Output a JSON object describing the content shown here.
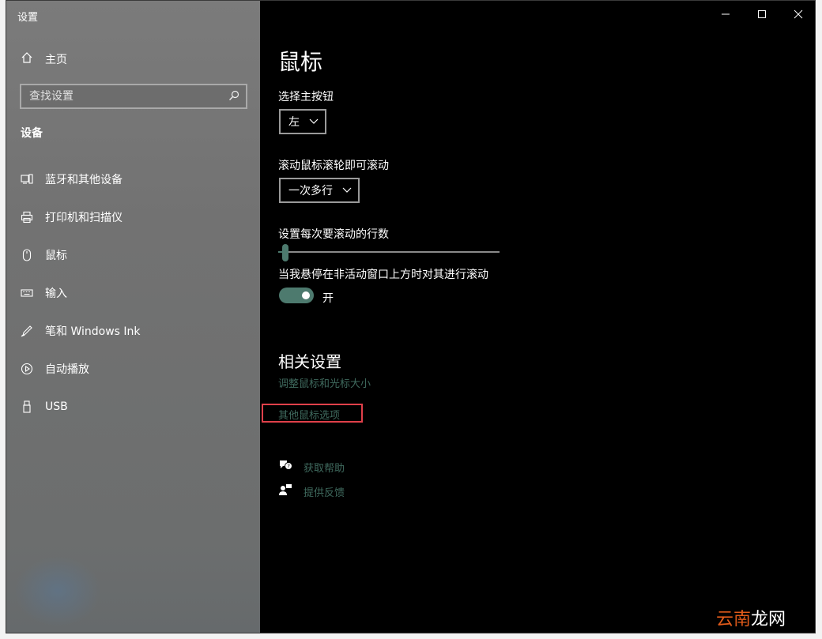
{
  "window": {
    "title": "设置"
  },
  "sidebar": {
    "home_label": "主页",
    "search_placeholder": "查找设置",
    "section_title": "设备",
    "items": [
      {
        "label": "蓝牙和其他设备",
        "icon": "bluetooth-devices-icon"
      },
      {
        "label": "打印机和扫描仪",
        "icon": "printer-icon"
      },
      {
        "label": "鼠标",
        "icon": "mouse-icon"
      },
      {
        "label": "输入",
        "icon": "keyboard-icon"
      },
      {
        "label": "笔和 Windows Ink",
        "icon": "pen-icon"
      },
      {
        "label": "自动播放",
        "icon": "autoplay-icon"
      },
      {
        "label": "USB",
        "icon": "usb-icon"
      }
    ]
  },
  "main": {
    "title": "鼠标",
    "primary_button_label": "选择主按钮",
    "primary_button_value": "左",
    "scroll_label": "滚动鼠标滚轮即可滚动",
    "scroll_value": "一次多行",
    "lines_label": "设置每次要滚动的行数",
    "lines_slider_fraction": 0.03,
    "inactive_scroll_label": "当我悬停在非活动窗口上方时对其进行滚动",
    "inactive_scroll_toggle_text": "开",
    "inactive_scroll_on": true,
    "related_title": "相关设置",
    "related_links": [
      "调整鼠标和光标大小",
      "其他鼠标选项"
    ],
    "help_label": "获取帮助",
    "feedback_label": "提供反馈"
  },
  "watermark": {
    "part1": "云南",
    "part2": "龙网"
  },
  "colors": {
    "accent": "#4d7a6e",
    "link": "#3f6a5e",
    "highlight": "#e0404a"
  }
}
